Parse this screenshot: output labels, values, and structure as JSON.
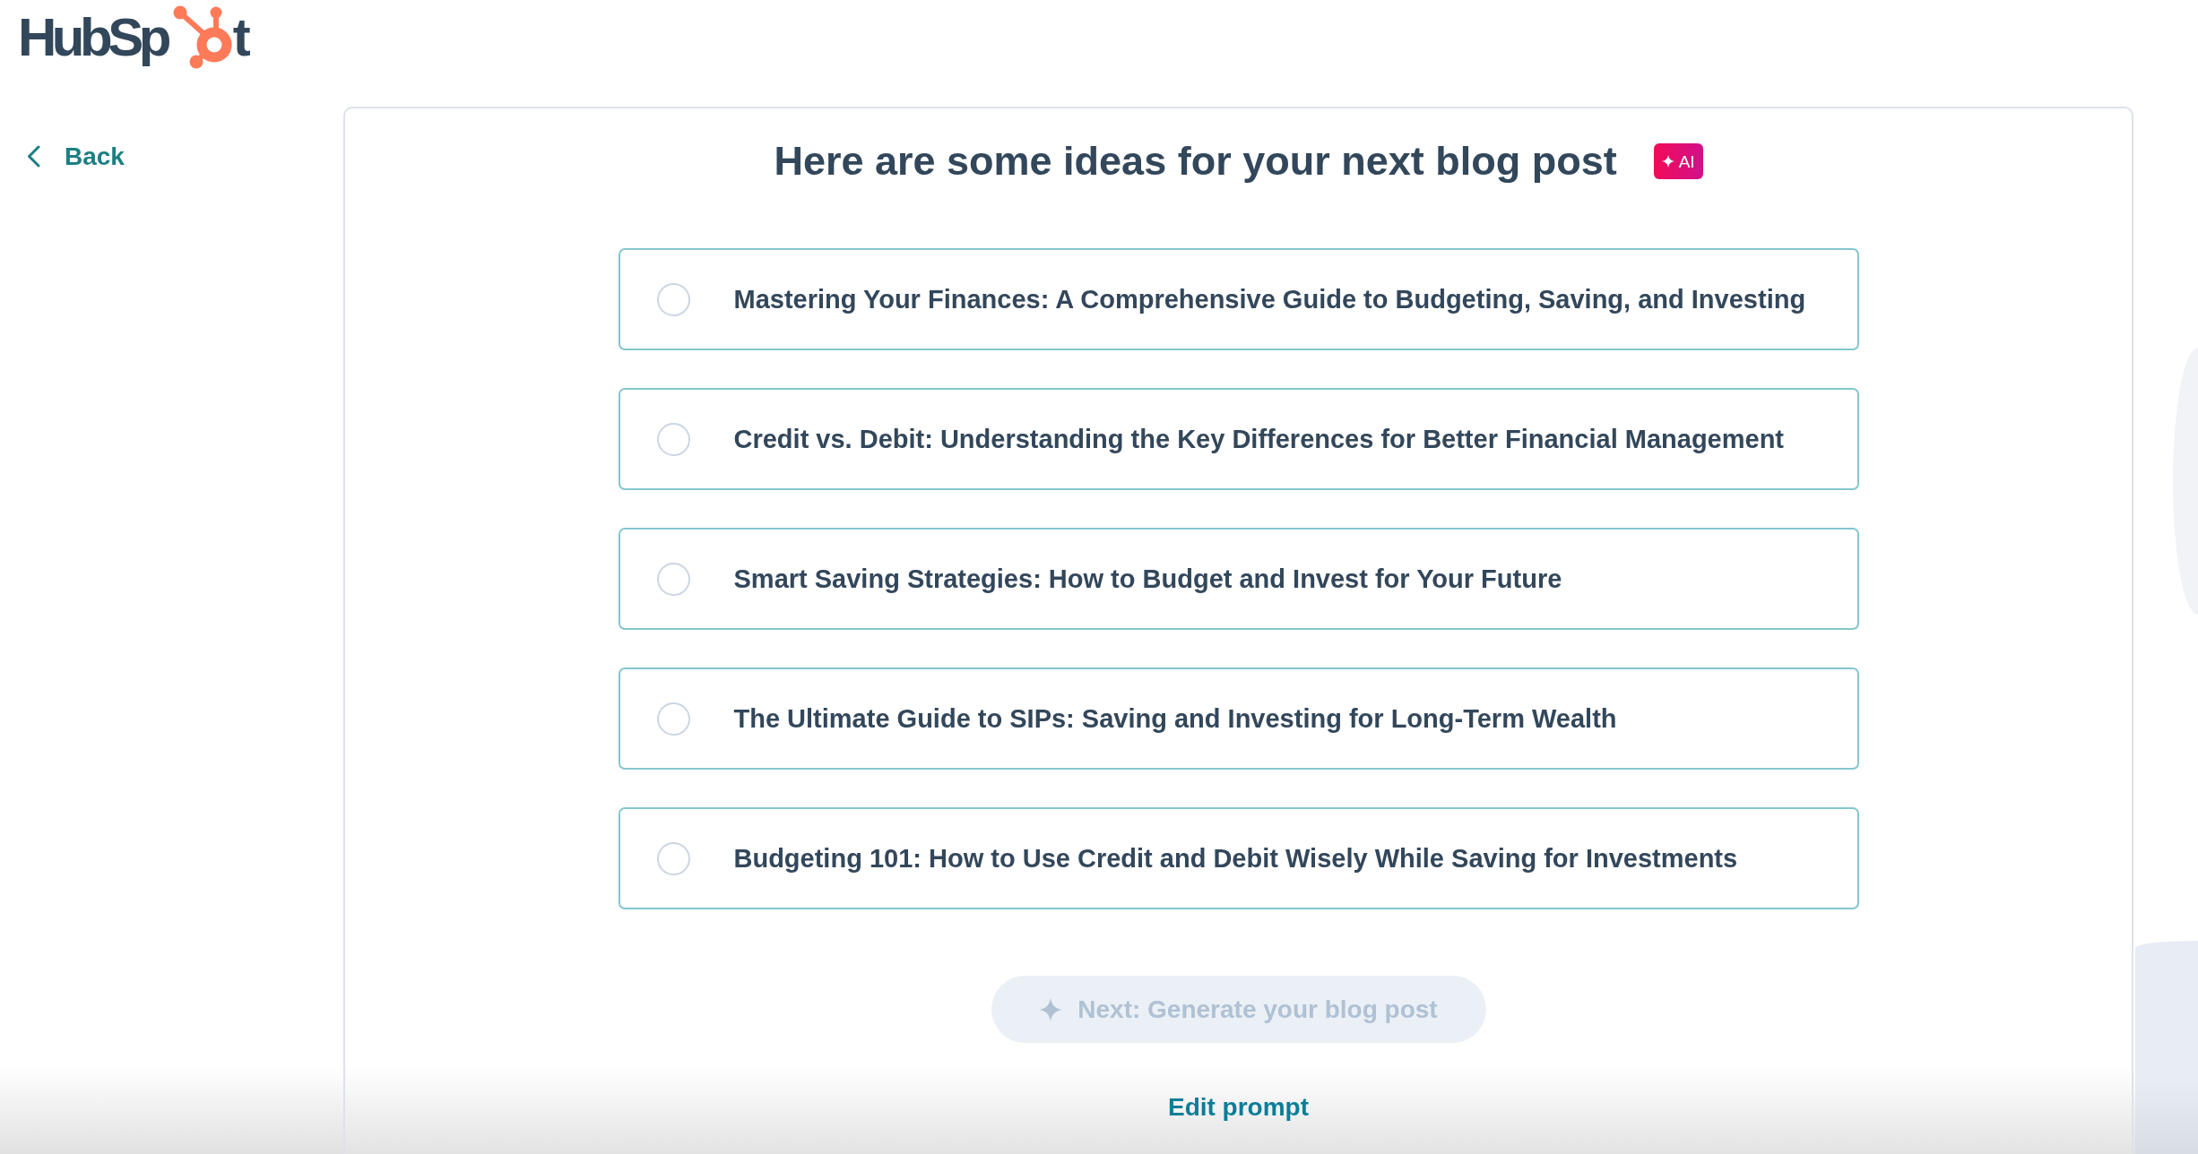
{
  "logo": {
    "text_start": "HubSp",
    "text_end": "t"
  },
  "back_link": {
    "label": "Back"
  },
  "heading": {
    "title": "Here are some ideas for your next blog post",
    "badge": "AI"
  },
  "ideas": [
    {
      "title": "Mastering Your Finances: A Comprehensive Guide to Budgeting, Saving, and Investing",
      "selected": false
    },
    {
      "title": "Credit vs. Debit: Understanding the Key Differences for Better Financial Management",
      "selected": false
    },
    {
      "title": "Smart Saving Strategies: How to Budget and Invest for Your Future",
      "selected": false
    },
    {
      "title": "The Ultimate Guide to SIPs: Saving and Investing for Long-Term Wealth",
      "selected": false
    },
    {
      "title": "Budgeting 101: How to Use Credit and Debit Wisely While Saving for Investments",
      "selected": false
    }
  ],
  "next_button": {
    "label": "Next: Generate your blog post",
    "disabled": true
  },
  "edit_prompt_link": {
    "label": "Edit prompt"
  }
}
